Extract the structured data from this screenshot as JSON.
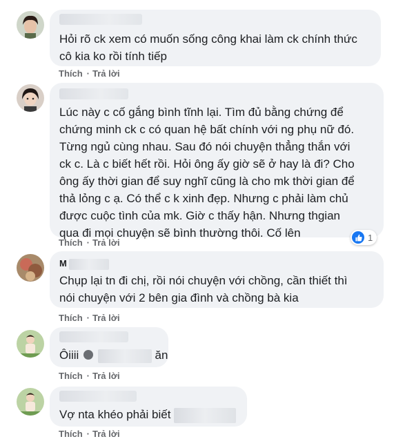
{
  "actions": {
    "like": "Thích",
    "reply": "Trả lời"
  },
  "comments": [
    {
      "name": "",
      "text": "Hỏi rõ ck xem có muốn sống công khai làm ck chính thức\ncô kia ko rồi tính tiếp"
    },
    {
      "name": "",
      "text": "Lúc này c cố gắng bình tĩnh lại. Tìm đủ bằng chứng để\nchứng minh ck c có quan hệ bất chính với ng phụ nữ đó.\nTừng ngủ cùng nhau. Sau đó nói chuyện thẳng thắn với\nck c. Là c biết hết rồi. Hỏi ông ấy giờ sẽ ở hay là đi? Cho\nông ấy thời gian để suy nghĩ cũng là cho mk thời gian để\nthả lỏng c ạ. Có thể c k xinh đẹp. Nhưng c phải làm chủ\nđược cuộc tình của mk. Giờ c thấy hận. Nhưng thgian\nqua đi mọi chuyện sẽ bình thường thôi. Cố lên",
      "reactions": "1"
    },
    {
      "name": "M",
      "text": "Chụp lại tn đi chị, rồi nói chuyện với chồng, cần thiết thì\nnói chuyện với 2 bên gia đình và chồng bà kia"
    },
    {
      "name": "",
      "text_start": "Ôiiii",
      "text_end": "ăn"
    },
    {
      "name": "",
      "text": "Vợ nta khéo phải biết"
    }
  ],
  "colors": {
    "bubble": "#f0f2f5",
    "meta": "#65676b",
    "like": "#1877f2"
  }
}
